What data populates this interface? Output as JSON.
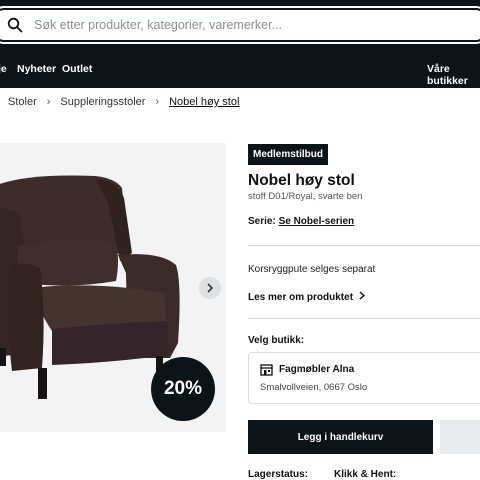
{
  "search": {
    "placeholder": "Søk etter produkter, kategorier, varemerker...",
    "value": ""
  },
  "nav": {
    "items": [
      {
        "label": "je"
      },
      {
        "label": "Nyheter"
      },
      {
        "label": "Outlet"
      }
    ],
    "stores_label": "Våre butikker"
  },
  "breadcrumb": {
    "items": [
      "Stoler",
      "Suppleringsstoler",
      "Nobel høy stol"
    ]
  },
  "product": {
    "badge": "Medlemstilbud",
    "title": "Nobel høy stol",
    "subtitle": "stoff D01/Royal, svarte ben",
    "serie_label": "Serie:",
    "serie_link": "Se Nobel-serien",
    "info": "Korsryggpute selges separat",
    "read_more": "Les mer om produktet",
    "discount": "20%",
    "upholstery_color": "#3a2a29"
  },
  "store": {
    "label": "Velg butikk:",
    "name": "Fagmøbler Alna",
    "address": "Smalvollveien, 0667 Oslo"
  },
  "actions": {
    "add_to_cart": "Legg i handlekurv"
  },
  "status": {
    "stock": "Lagerstatus:",
    "click_collect": "Klikk & Hent:"
  },
  "colors": {
    "dark": "#0d1418",
    "image_bg": "#f3f3f3"
  }
}
